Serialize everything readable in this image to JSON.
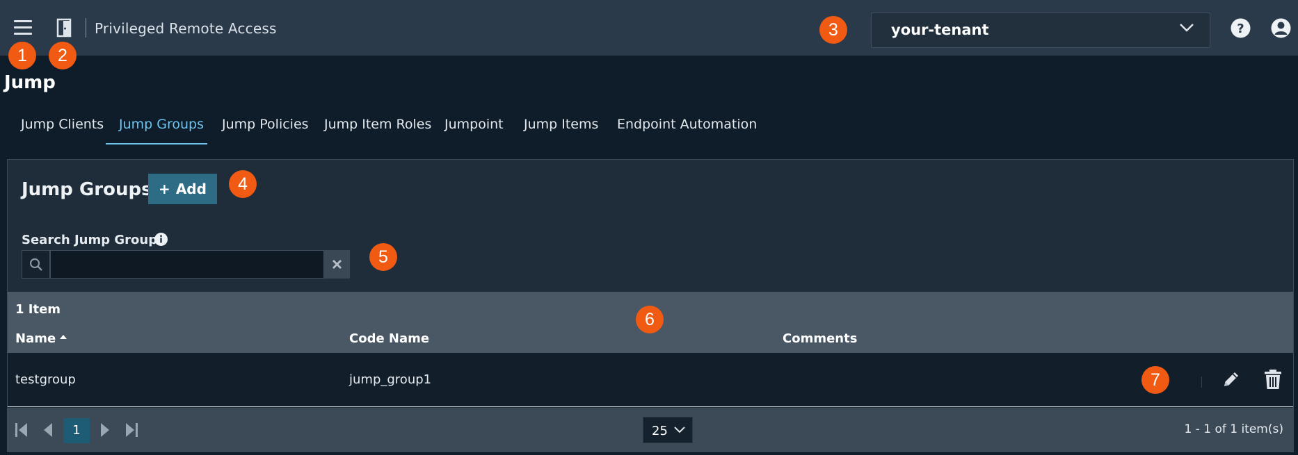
{
  "header": {
    "app_title": "Privileged Remote Access",
    "tenant": "your-tenant",
    "menu_icon": "hamburger-icon",
    "logo_icon": "door-logo-icon",
    "help_icon": "help-icon",
    "user_icon": "user-account-icon"
  },
  "page": {
    "title": "Jump"
  },
  "tabs": [
    {
      "label": "Jump Clients"
    },
    {
      "label": "Jump Groups",
      "active": true
    },
    {
      "label": "Jump Policies"
    },
    {
      "label": "Jump Item Roles"
    },
    {
      "label": "Jumpoint"
    },
    {
      "label": "Jump Items"
    },
    {
      "label": "Endpoint Automation"
    }
  ],
  "panel": {
    "title": "Jump Groups",
    "add_label": "Add",
    "search_label": "Search Jump Groups",
    "search_value": ""
  },
  "grid": {
    "item_count": "1 Item",
    "columns": [
      "Name",
      "Code Name",
      "Comments"
    ],
    "sort_column": "Name",
    "sort_direction": "ascending",
    "rows": [
      {
        "name": "testgroup",
        "code_name": "jump_group1",
        "comments": ""
      }
    ]
  },
  "pager": {
    "current_page": "1",
    "page_size": "25",
    "summary": "1 - 1 of 1 item(s)"
  },
  "annotations": [
    "1",
    "2",
    "3",
    "4",
    "5",
    "6",
    "7"
  ],
  "colors": {
    "accent": "#6cc4f0",
    "annotation": "#f05a12",
    "button": "#2e6b85",
    "topbar": "#2b3a4a",
    "background": "#0f1c29"
  }
}
